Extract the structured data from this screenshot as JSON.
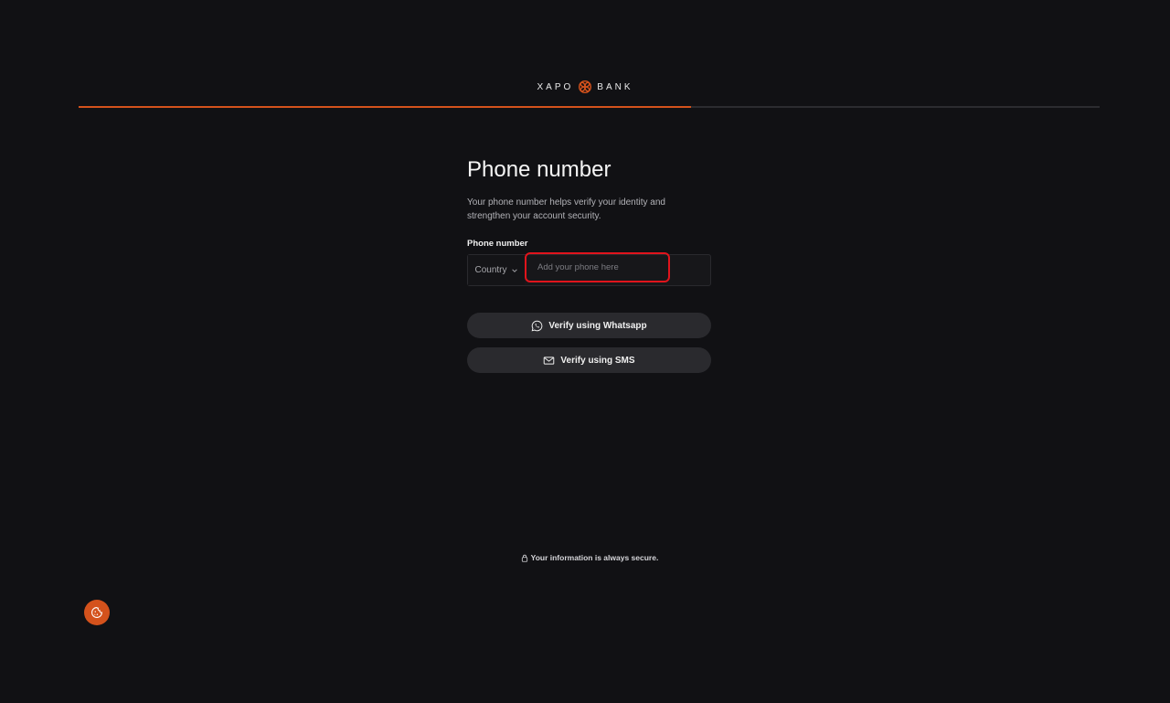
{
  "header": {
    "logo_left": "XAPO",
    "logo_right": "BANK",
    "progress": 0.6
  },
  "form": {
    "title": "Phone number",
    "subtitle": "Your phone number helps verify your identity and strengthen your account security.",
    "field_label": "Phone number",
    "country_label": "Country",
    "phone_placeholder": "Add your phone here",
    "phone_value": ""
  },
  "buttons": {
    "whatsapp": "Verify using Whatsapp",
    "sms": "Verify using SMS"
  },
  "footer": {
    "secure_note": "Your information is always secure."
  },
  "colors": {
    "accent": "#d4521c",
    "highlight": "#e0141c",
    "background": "#111114"
  },
  "icons": {
    "logo": "xapo-logo-icon",
    "chevron": "chevron-down-icon",
    "whatsapp": "whatsapp-icon",
    "sms": "mail-icon",
    "lock": "lock-icon",
    "cookie": "cookie-icon"
  }
}
